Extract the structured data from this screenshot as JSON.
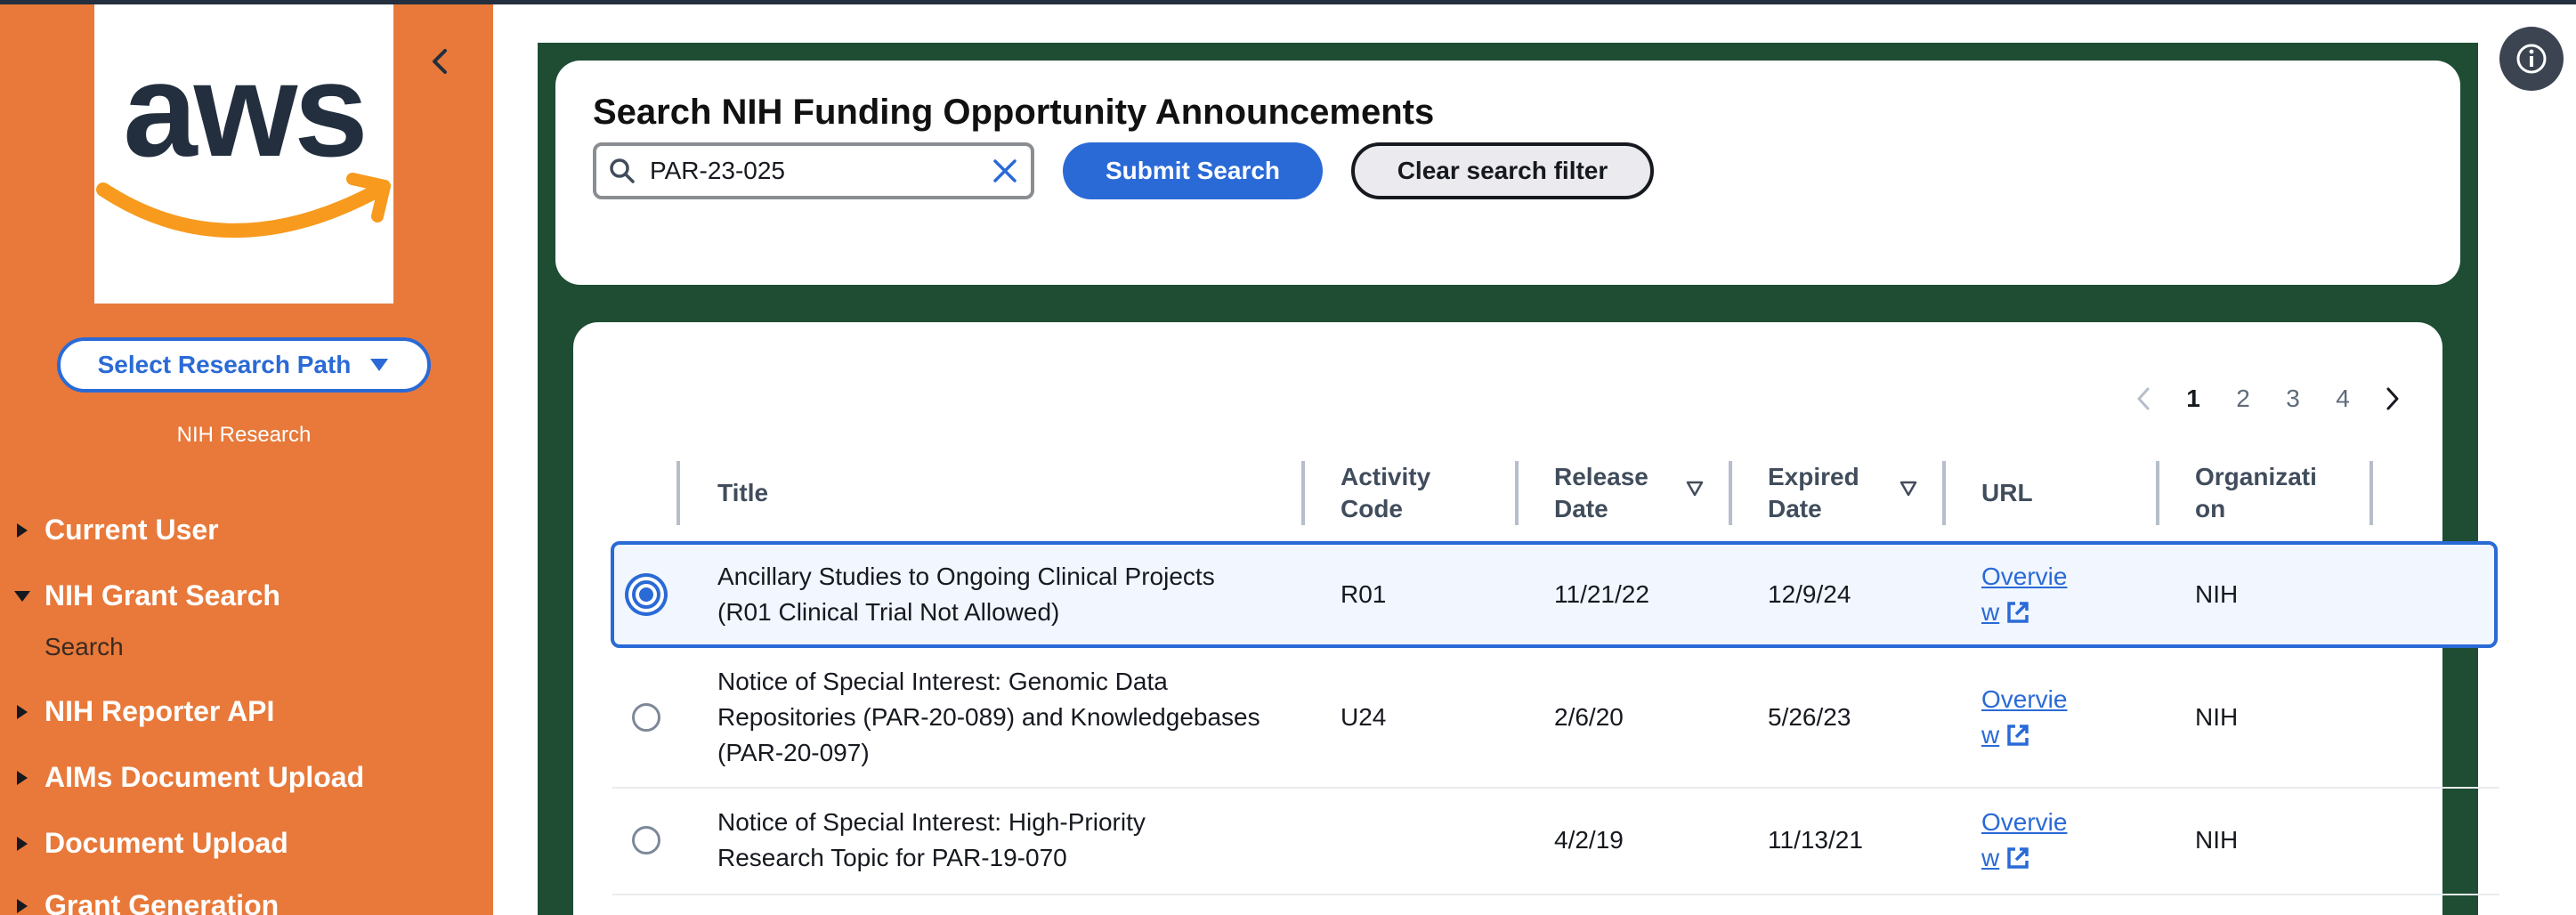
{
  "sidebar": {
    "path_button": "Select Research Path",
    "path_caption": "NIH Research",
    "items": [
      {
        "label": "Current User",
        "expanded": false
      },
      {
        "label": "NIH Grant Search",
        "expanded": true
      },
      {
        "label": "NIH Reporter API",
        "expanded": false
      },
      {
        "label": "AIMs Document Upload",
        "expanded": false
      },
      {
        "label": "Document Upload",
        "expanded": false
      },
      {
        "label": "Grant Generation",
        "expanded": false
      }
    ],
    "sub_item": "Search"
  },
  "search": {
    "title": "Search NIH Funding Opportunity Announcements",
    "value": "PAR-23-025",
    "submit_label": "Submit Search",
    "clear_label": "Clear search filter"
  },
  "pagination": {
    "pages": [
      "1",
      "2",
      "3",
      "4"
    ],
    "current": "1"
  },
  "table": {
    "headers": {
      "title": "Title",
      "activity_code_1": "Activity",
      "activity_code_2": "Code",
      "release_date_1": "Release",
      "release_date_2": "Date",
      "expired_date_1": "Expired",
      "expired_date_2": "Date",
      "url": "URL",
      "organization_1": "Organizati",
      "organization_2": "on"
    },
    "rows": [
      {
        "selected": true,
        "title_lines": [
          "Ancillary Studies to Ongoing Clinical Projects",
          "(R01 Clinical Trial Not Allowed)"
        ],
        "activity_code": "R01",
        "release_date": "11/21/22",
        "expired_date": "12/9/24",
        "url_line1": "Overvie",
        "url_line2": "w",
        "organization": "NIH"
      },
      {
        "selected": false,
        "title_lines": [
          "Notice of Special Interest: Genomic Data",
          "Repositories (PAR-20-089) and Knowledgebases",
          "(PAR-20-097)"
        ],
        "activity_code": "U24",
        "release_date": "2/6/20",
        "expired_date": "5/26/23",
        "url_line1": "Overvie",
        "url_line2": "w",
        "organization": "NIH"
      },
      {
        "selected": false,
        "title_lines": [
          "Notice of Special Interest: High-Priority",
          "Research Topic for PAR-19-070"
        ],
        "activity_code": "",
        "release_date": "4/2/19",
        "expired_date": "11/13/21",
        "url_line1": "Overvie",
        "url_line2": "w",
        "organization": "NIH"
      }
    ]
  },
  "colors": {
    "sidebar_bg": "#e8793a",
    "main_bg": "#1e4d33",
    "accent": "#2a6ad6"
  },
  "icons": {
    "logo": "aws-logo",
    "collapse": "chevron-left-icon",
    "dropdown": "caret-down-icon",
    "search": "search-icon",
    "clear": "close-icon",
    "external": "external-link-icon",
    "info": "info-icon"
  }
}
